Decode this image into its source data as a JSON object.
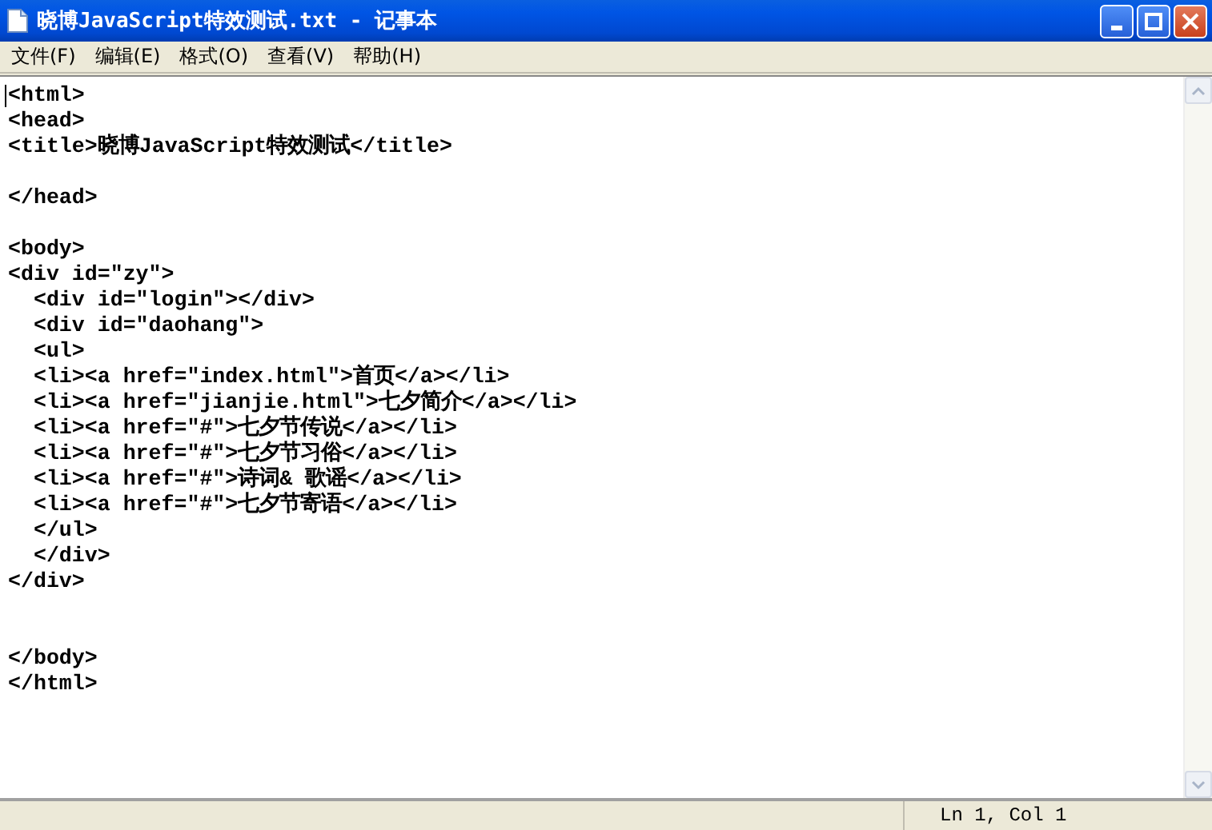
{
  "window": {
    "title": "晓博JavaScript特效测试.txt - 记事本"
  },
  "menu": [
    {
      "label": "文件(F)"
    },
    {
      "label": "编辑(E)"
    },
    {
      "label": "格式(O)"
    },
    {
      "label": "查看(V)"
    },
    {
      "label": "帮助(H)"
    }
  ],
  "editor": {
    "lines": [
      {
        "kind": "text",
        "text": "<html>"
      },
      {
        "kind": "text",
        "text": "<head>"
      },
      {
        "kind": "text",
        "text": "<title>晓博JavaScript特效测试</title>"
      },
      {
        "kind": "blank"
      },
      {
        "kind": "text",
        "text": "</head>"
      },
      {
        "kind": "blank"
      },
      {
        "kind": "text",
        "text": "<body>"
      },
      {
        "kind": "text",
        "text": "<div id=\"zy\">"
      },
      {
        "kind": "text",
        "text": "  <div id=\"login\"></div>"
      },
      {
        "kind": "text",
        "text": "  <div id=\"daohang\">"
      },
      {
        "kind": "text",
        "text": "  <ul>"
      },
      {
        "kind": "text",
        "text": "  <li><a href=\"index.html\">首页</a></li>"
      },
      {
        "kind": "text",
        "text": "  <li><a href=\"jianjie.html\">七夕简介</a></li>"
      },
      {
        "kind": "text",
        "text": "  <li><a href=\"#\">七夕节传说</a></li>"
      },
      {
        "kind": "text",
        "text": "  <li><a href=\"#\">七夕节习俗</a></li>"
      },
      {
        "kind": "text",
        "text": "  <li><a href=\"#\">诗词& 歌谣</a></li>"
      },
      {
        "kind": "text",
        "text": "  <li><a href=\"#\">七夕节寄语</a></li>"
      },
      {
        "kind": "text",
        "text": "  </ul>"
      },
      {
        "kind": "text",
        "text": "  </div>"
      },
      {
        "kind": "text",
        "text": "</div>"
      },
      {
        "kind": "blank"
      },
      {
        "kind": "blank"
      },
      {
        "kind": "text",
        "text": "</body>"
      },
      {
        "kind": "text",
        "text": "</html>"
      }
    ]
  },
  "status_bar": {
    "position": "Ln 1, Col 1"
  }
}
